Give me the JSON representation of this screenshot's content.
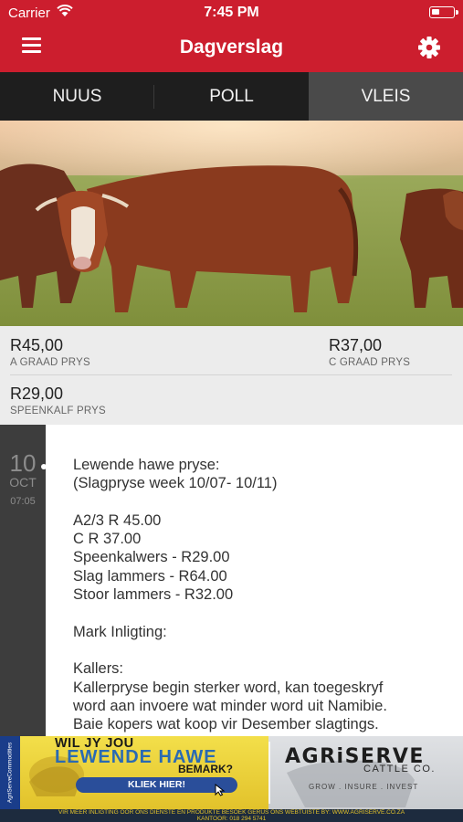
{
  "status_bar": {
    "carrier": "Carrier",
    "time": "7:45 PM"
  },
  "header": {
    "title": "Dagverslag",
    "menu_icon": "hamburger-menu-icon",
    "settings_icon": "gear-icon",
    "brand_color": "#cc1e2e"
  },
  "tabs": [
    {
      "label": "NUUS",
      "active": false
    },
    {
      "label": "POLL",
      "active": false
    },
    {
      "label": "VLEIS",
      "active": true
    }
  ],
  "prices": [
    {
      "value": "R45,00",
      "label": "A GRAAD PRYS"
    },
    {
      "value": "R37,00",
      "label": "C GRAAD PRYS"
    },
    {
      "value": "R29,00",
      "label": "SPEENKALF PRYS"
    }
  ],
  "post": {
    "day": "10",
    "month": "OCT",
    "time": "07:05",
    "lines": [
      "Lewende hawe pryse:",
      "(Slagpryse week 10/07- 10/11)",
      "",
      "A2/3 R 45.00",
      "C R 37.00",
      "Speenkalwers - R29.00",
      "Slag lammers - R64.00",
      "Stoor lammers - R32.00",
      "",
      "Mark Inligting:",
      "",
      "Kallers:",
      "Kallerpryse begin sterker word, kan toegeskryf",
      "word aan invoere wat minder word uit Namibie.",
      "Baie kopers wat koop vir Desember slagtings."
    ]
  },
  "banner": {
    "side_text": "AgriServeCommodities",
    "question": "WIL JY JOU",
    "headline": "LEWENDE HAWE",
    "headline2": "BEMARK?",
    "button": "KLIEK HIER!",
    "brand": "AGRiSERVE",
    "brand_sub": "CATTLE CO.",
    "brand_tagline": "GROW . INSURE . INVEST",
    "footer_line1": "VIR MEER INLIGTING OOR ONS DIENSTE EN PRODUKTE BESOEK GERUS ONS WEBTUISTE BY: WWW.AGRISERVE.CO.ZA",
    "footer_line2": "KANTOOR: 018 294 5741"
  }
}
